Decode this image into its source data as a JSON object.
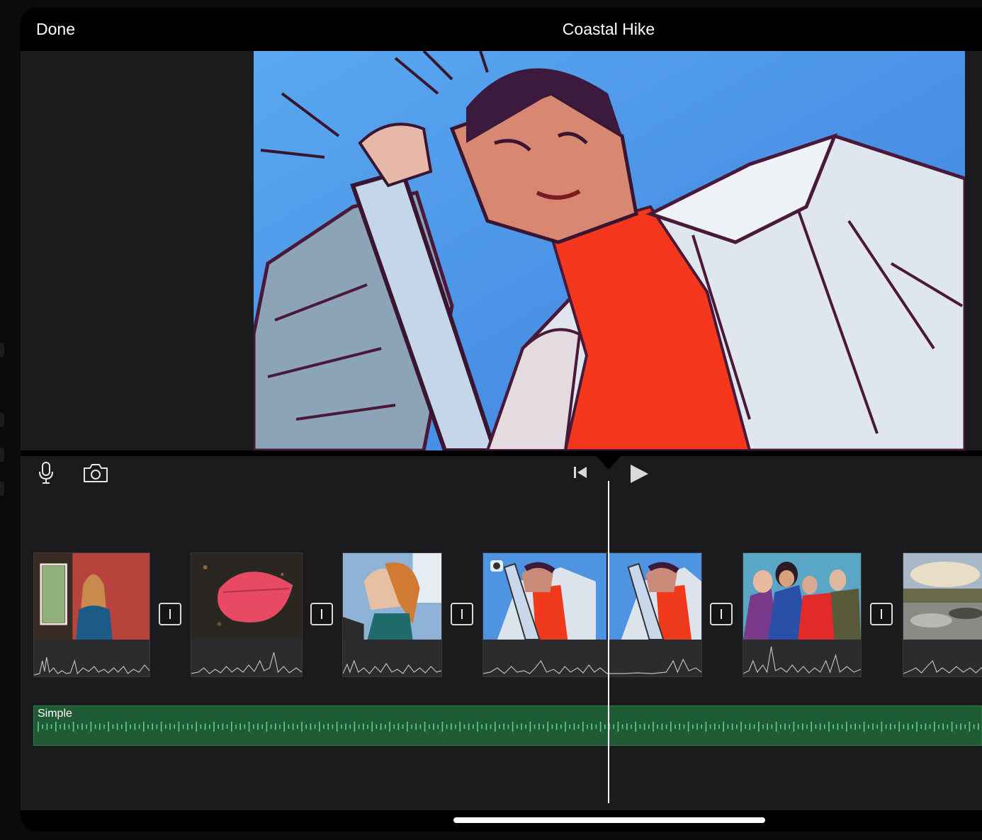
{
  "topbar": {
    "done_label": "Done",
    "title": "Coastal Hike"
  },
  "toolbar": {
    "icons": [
      "microphone-icon",
      "camera-icon",
      "skip-to-start-icon",
      "play-icon"
    ]
  },
  "clips": [
    {
      "kind": "video",
      "subject": "woman in red room"
    },
    {
      "kind": "video",
      "subject": "red leaf"
    },
    {
      "kind": "video",
      "subject": "profile portrait"
    },
    {
      "kind": "video",
      "subject": "comic-style woman with ladder",
      "has_filter_badge": true
    },
    {
      "kind": "video",
      "subject": "group of friends"
    },
    {
      "kind": "video",
      "subject": "rocky coastline"
    }
  ],
  "music_track": {
    "label": "Simple",
    "color": "#1f5c36"
  },
  "colors": {
    "accent_white": "#ffffff",
    "background": "#1b1b1d",
    "music_green": "#1f5c36"
  }
}
